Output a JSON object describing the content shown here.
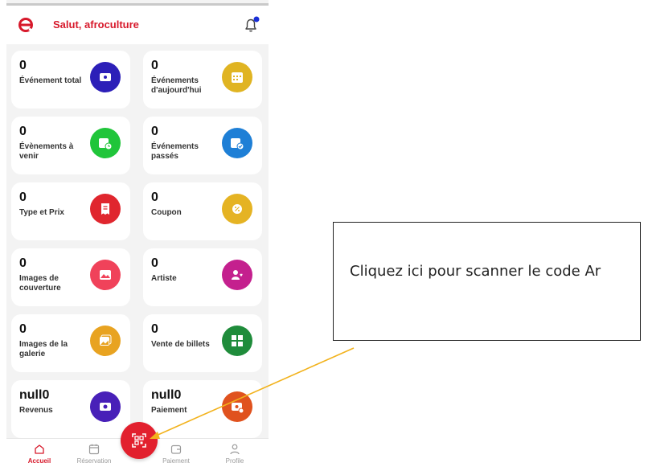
{
  "header": {
    "greeting": "Salut, afroculture"
  },
  "cards": [
    {
      "value": "0",
      "label": "Événement total",
      "color": "#2c1fb8",
      "icon": "ticket-icon"
    },
    {
      "value": "0",
      "label": "Événements d'aujourd'hui",
      "color": "#e0b422",
      "icon": "calendar-icon"
    },
    {
      "value": "0",
      "label": "Évènements à venir",
      "color": "#20c53a",
      "icon": "calendar-clock-icon"
    },
    {
      "value": "0",
      "label": "Événements passés",
      "color": "#1e7fd6",
      "icon": "calendar-check-icon"
    },
    {
      "value": "0",
      "label": "Type et Prix",
      "color": "#e0262e",
      "icon": "receipt-icon"
    },
    {
      "value": "0",
      "label": "Coupon",
      "color": "#e5b323",
      "icon": "coupon-icon"
    },
    {
      "value": "0",
      "label": "Images de couverture",
      "color": "#f0425a",
      "icon": "image-icon"
    },
    {
      "value": "0",
      "label": "Artiste",
      "color": "#c4208e",
      "icon": "artist-icon"
    },
    {
      "value": "0",
      "label": "Images de la galerie",
      "color": "#e8a321",
      "icon": "gallery-icon"
    },
    {
      "value": "0",
      "label": "Vente de billets",
      "color": "#1f8c3b",
      "icon": "tickets-icon"
    },
    {
      "value": "null0",
      "label": "Revenus",
      "color": "#4820b8",
      "icon": "money-icon"
    },
    {
      "value": "null0",
      "label": "Paiement",
      "color": "#e0521e",
      "icon": "payment-icon"
    }
  ],
  "nav": [
    {
      "label": "Accueil",
      "icon": "home-icon"
    },
    {
      "label": "Réservation",
      "icon": "calendar-icon"
    },
    {
      "label": "Paiement",
      "icon": "wallet-icon"
    },
    {
      "label": "Profile",
      "icon": "user-icon"
    }
  ],
  "scan_button": {
    "icon": "qr-scan-icon"
  },
  "callout": {
    "text": "Cliquez ici pour scanner le code Ar"
  },
  "colors": {
    "brand": "#d7192b",
    "arrow": "#f2b21c"
  }
}
